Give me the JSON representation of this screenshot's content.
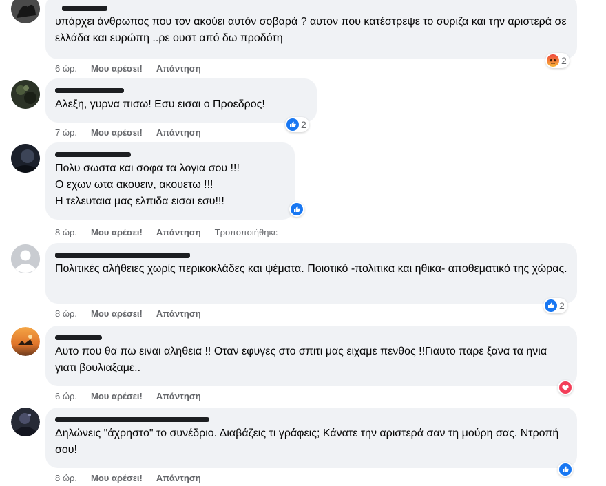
{
  "comments": [
    {
      "text": "υπάρχει άνθρωπος που τον ακούει αυτόν σοβαρά ? αυτον που κατέστρεψε το συριζα και την αριστερά σε ελλάδα και ευρώπη ..ρε ουστ από δω προδότη",
      "time": "6 ώρ.",
      "like_label": "Μου αρέσει!",
      "reply_label": "Απάντηση",
      "reaction_icon": "angry-icon",
      "reaction_count": "2"
    },
    {
      "text": "Αλεξη, γυρνα πισω! Εσυ εισαι ο Προεδρος!",
      "time": "7 ώρ.",
      "like_label": "Μου αρέσει!",
      "reply_label": "Απάντηση",
      "reaction_icon": "like-icon",
      "reaction_count": "2"
    },
    {
      "text": "Πολυ σωστα και σοφα τα λογια σου !!!\nΟ εχων ωτα ακουειν, ακουετω !!!\nΗ τελευταια μας ελπιδα εισαι εσυ!!!",
      "time": "8 ώρ.",
      "like_label": "Μου αρέσει!",
      "reply_label": "Απάντηση",
      "edited_label": "Τροποποιήθηκε",
      "reaction_icon": "like-icon",
      "reaction_count": ""
    },
    {
      "text": "Πολιτικές αλήθειες χωρίς περικοκλάδες και ψέματα. Ποιοτικό -πολιτικα και ηθικα- αποθεματικό της χώρας.",
      "time": "8 ώρ.",
      "like_label": "Μου αρέσει!",
      "reply_label": "Απάντηση",
      "reaction_icon": "like-icon",
      "reaction_count": "2"
    },
    {
      "text": "Αυτο που θα πω ειναι αληθεια !! Οταν εφυγες στο σπιτι μας ειχαμε πενθος !!Γιαυτο παρε ξανα τα ηνια γιατι βουλιαξαμε..",
      "time": "6 ώρ.",
      "like_label": "Μου αρέσει!",
      "reply_label": "Απάντηση",
      "reaction_icon": "love-icon",
      "reaction_count": ""
    },
    {
      "text": "Δηλώνεις \"άχρηστο\" το συνέδριο. Διαβάζεις τι γράφεις; Κάνατε την αριστερά σαν τη μούρη σας. Ντροπή σου!",
      "time": "8 ώρ.",
      "like_label": "Μου αρέσει!",
      "reply_label": "Απάντηση",
      "reaction_icon": "like-icon",
      "reaction_count": ""
    }
  ],
  "colors": {
    "like": "#1877f2",
    "love": "#f33e58",
    "angry": "#e9710f",
    "bubble": "#f0f2f5",
    "meta": "#65676b"
  }
}
